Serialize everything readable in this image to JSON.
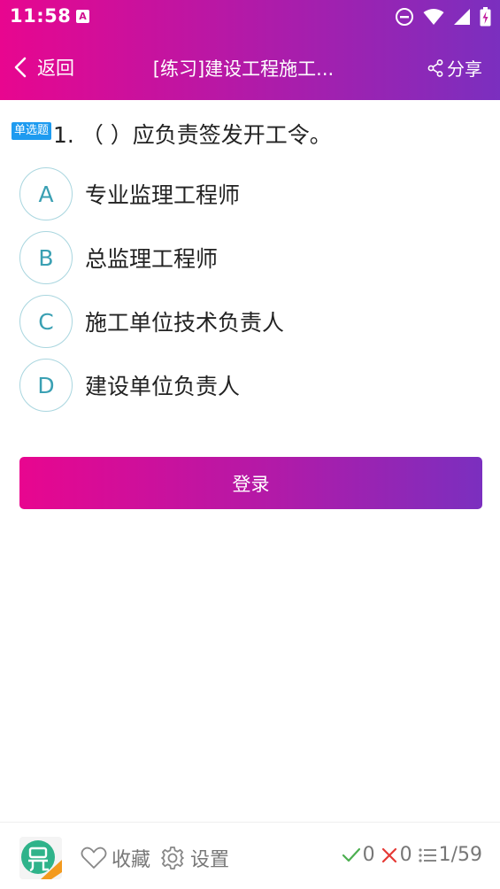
{
  "status": {
    "time": "11:58",
    "notification_icon_letter": "A"
  },
  "nav": {
    "back_label": "返回",
    "title": "[练习]建设工程施工...",
    "share_label": "分享"
  },
  "question": {
    "type_label": "单选题",
    "text": "1. （   ）应负责签发开工令。",
    "options": [
      {
        "letter": "A",
        "text": "专业监理工程师"
      },
      {
        "letter": "B",
        "text": "总监理工程师"
      },
      {
        "letter": "C",
        "text": "施工单位技术负责人"
      },
      {
        "letter": "D",
        "text": "建设单位负责人"
      }
    ]
  },
  "login_label": "登录",
  "bottom": {
    "favorite_label": "收藏",
    "settings_label": "设置",
    "correct_count": "0",
    "wrong_count": "0",
    "progress": "1/59"
  },
  "colors": {
    "gradient_start": "#e8068f",
    "gradient_end": "#7b2fbf",
    "option_circle": "#3aa0b3",
    "badge": "#1e9bf0",
    "correct": "#4caf50",
    "wrong": "#e53935"
  }
}
